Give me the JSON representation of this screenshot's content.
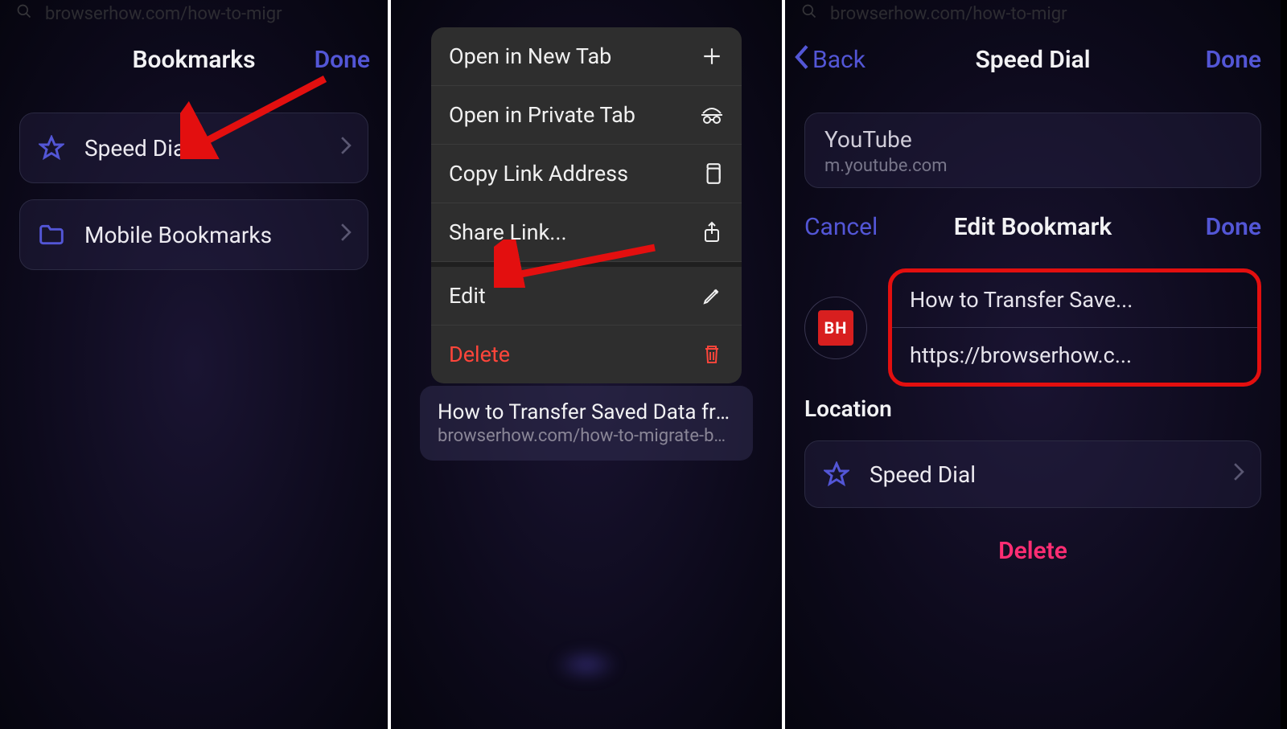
{
  "addressbar": {
    "text": "browserhow.com/how-to-migr"
  },
  "panel1": {
    "title": "Bookmarks",
    "done": "Done",
    "items": [
      {
        "label": "Speed Dial",
        "icon": "star"
      },
      {
        "label": "Mobile Bookmarks",
        "icon": "folder"
      }
    ]
  },
  "panel2": {
    "menu": [
      {
        "label": "Open in New Tab",
        "icon": "plus"
      },
      {
        "label": "Open in Private Tab",
        "icon": "incognito"
      },
      {
        "label": "Copy Link Address",
        "icon": "copy"
      },
      {
        "label": "Share Link...",
        "icon": "share"
      }
    ],
    "menu2": [
      {
        "label": "Edit",
        "icon": "pencil"
      },
      {
        "label": "Delete",
        "icon": "trash",
        "destructive": true
      }
    ],
    "preview": {
      "title": "How to Transfer Saved Data fro...",
      "subtitle": "browserhow.com/how-to-migrate-bookmar..."
    }
  },
  "panel3": {
    "back": "Back",
    "title": "Speed Dial",
    "done_top": "Done",
    "ytcard": {
      "title": "YouTube",
      "subtitle": "m.youtube.com"
    },
    "sheet": {
      "cancel": "Cancel",
      "title": "Edit Bookmark",
      "done": "Done"
    },
    "favicon_text": "BH",
    "edit": {
      "name": "How to Transfer Save...",
      "url": "https://browserhow.c..."
    },
    "location_label": "Location",
    "location_value": "Speed Dial",
    "delete": "Delete"
  }
}
